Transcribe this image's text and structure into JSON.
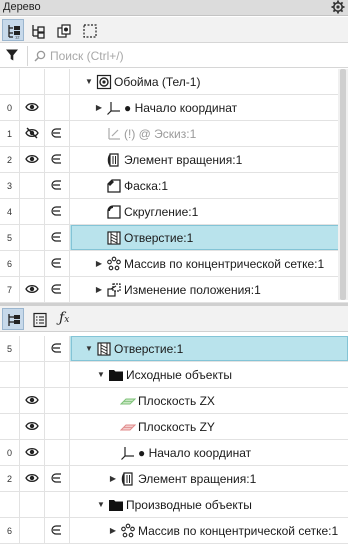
{
  "panel": {
    "title": "Дерево"
  },
  "search": {
    "placeholder": "Поиск (Ctrl+/)"
  },
  "tree_top": [
    {
      "idx": "",
      "vis": "",
      "incl": "",
      "arrow": "▼",
      "icon": "assembly-icon",
      "label": "Обойма (Тел-1)",
      "gray": false,
      "sel": false
    },
    {
      "idx": "0",
      "vis": "eye",
      "incl": "",
      "arrow": "▶",
      "icon": "origin-icon",
      "label": "● Начало координат",
      "gray": false,
      "sel": false
    },
    {
      "idx": "1",
      "vis": "eye-off",
      "incl": "elem",
      "arrow": "",
      "icon": "sketch-icon",
      "label": "(!) @ Эскиз:1",
      "gray": true,
      "sel": false
    },
    {
      "idx": "2",
      "vis": "eye",
      "incl": "elem",
      "arrow": "",
      "icon": "revolve-icon",
      "label": "Элемент вращения:1",
      "gray": false,
      "sel": false
    },
    {
      "idx": "3",
      "vis": "",
      "incl": "elem",
      "arrow": "",
      "icon": "chamfer-icon",
      "label": "Фаска:1",
      "gray": false,
      "sel": false
    },
    {
      "idx": "4",
      "vis": "",
      "incl": "elem",
      "arrow": "",
      "icon": "fillet-icon",
      "label": "Скругление:1",
      "gray": false,
      "sel": false
    },
    {
      "idx": "5",
      "vis": "",
      "incl": "elem",
      "arrow": "",
      "icon": "hole-icon",
      "label": "Отверстие:1",
      "gray": false,
      "sel": true
    },
    {
      "idx": "6",
      "vis": "",
      "incl": "elem",
      "arrow": "▶",
      "icon": "circular-pattern-icon",
      "label": "Массив по концентрической сетке:1",
      "gray": false,
      "sel": false
    },
    {
      "idx": "7",
      "vis": "eye",
      "incl": "elem",
      "arrow": "▶",
      "icon": "move-icon",
      "label": "Изменение положения:1",
      "gray": false,
      "sel": false
    }
  ],
  "tree_bottom": [
    {
      "idx": "5",
      "vis": "",
      "incl": "elem",
      "arrow": "▼",
      "icon": "hole-icon",
      "label": "Отверстие:1",
      "gray": false,
      "sel": true,
      "indent": 0
    },
    {
      "idx": "",
      "vis": "",
      "incl": "",
      "arrow": "▼",
      "icon": "folder-icon",
      "label": "Исходные объекты",
      "gray": false,
      "sel": false,
      "indent": 1
    },
    {
      "idx": "",
      "vis": "eye",
      "incl": "",
      "arrow": "",
      "icon": "plane-zx-icon",
      "label": "Плоскость ZX",
      "gray": false,
      "sel": false,
      "indent": 2
    },
    {
      "idx": "",
      "vis": "eye",
      "incl": "",
      "arrow": "",
      "icon": "plane-zy-icon",
      "label": "Плоскость ZY",
      "gray": false,
      "sel": false,
      "indent": 2
    },
    {
      "idx": "0",
      "vis": "eye",
      "incl": "",
      "arrow": "",
      "icon": "origin-icon",
      "label": "● Начало координат",
      "gray": false,
      "sel": false,
      "indent": 2
    },
    {
      "idx": "2",
      "vis": "eye",
      "incl": "elem",
      "arrow": "▶",
      "icon": "revolve-icon",
      "label": "Элемент вращения:1",
      "gray": false,
      "sel": false,
      "indent": 2
    },
    {
      "idx": "",
      "vis": "",
      "incl": "",
      "arrow": "▼",
      "icon": "folder-icon",
      "label": "Производные объекты",
      "gray": false,
      "sel": false,
      "indent": 1
    },
    {
      "idx": "6",
      "vis": "",
      "incl": "elem",
      "arrow": "▶",
      "icon": "circular-pattern-icon",
      "label": "Массив по концентрической сетке:1",
      "gray": false,
      "sel": false,
      "indent": 2
    }
  ],
  "colors": {
    "selection": "#b9e3ec",
    "selection_border": "#83c4d6",
    "header": "#dcdcdc",
    "accent": "#c7d9ea"
  }
}
